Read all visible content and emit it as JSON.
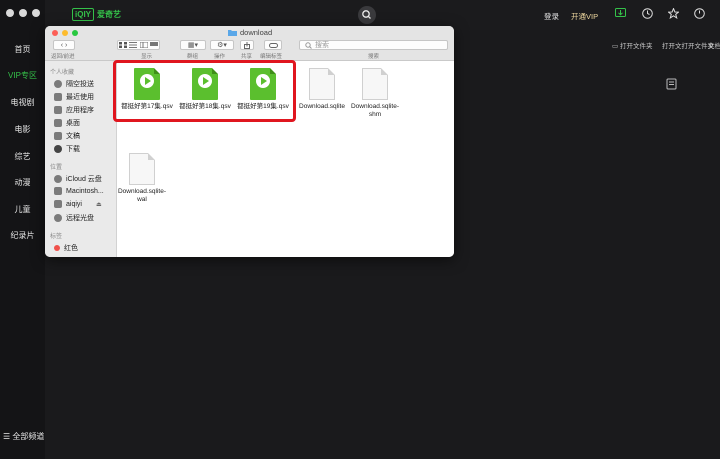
{
  "app": {
    "logo_box": "iQIY",
    "logo_text": "爱奇艺",
    "nav": [
      "首页",
      "VIP专区",
      "电视剧",
      "电影",
      "综艺",
      "动漫",
      "儿童",
      "纪录片"
    ],
    "all_channels": "全部频道",
    "login": "登录",
    "vip": "开通VIP",
    "open_folder_1": "打开文件夹",
    "open_folder_2": "打开文打开文件夹",
    "doc_cut": "文档",
    "accent": "#35c24a"
  },
  "finder": {
    "title": "download",
    "back_forward": "返回/前进",
    "toolbar_labels": {
      "view": "显示",
      "group": "群组",
      "action": "操作",
      "share": "共享",
      "tags": "编辑标签",
      "search": "搜索"
    },
    "search_placeholder": "搜索",
    "sidebar": {
      "favorites_head": "个人收藏",
      "favorites": [
        "隔空投送",
        "最近使用",
        "应用程序",
        "桌面",
        "文稿",
        "下载"
      ],
      "locations_head": "位置",
      "locations": [
        "iCloud 云盘",
        "Macintosh...",
        "aiqiyi",
        "远程光盘"
      ],
      "tags_head": "标签",
      "tags": [
        "红色"
      ]
    },
    "files": [
      {
        "name": "都挺好第17集.qsv",
        "kind": "qsv"
      },
      {
        "name": "都挺好第18集.qsv",
        "kind": "qsv"
      },
      {
        "name": "都挺好第19集.qsv",
        "kind": "qsv"
      },
      {
        "name": "Download.sqlite",
        "kind": "doc"
      },
      {
        "name": "Download.sqlite-shm",
        "kind": "doc"
      },
      {
        "name": "Download.sqlite-wal",
        "kind": "doc"
      }
    ],
    "highlight_color": "#e0161f"
  }
}
